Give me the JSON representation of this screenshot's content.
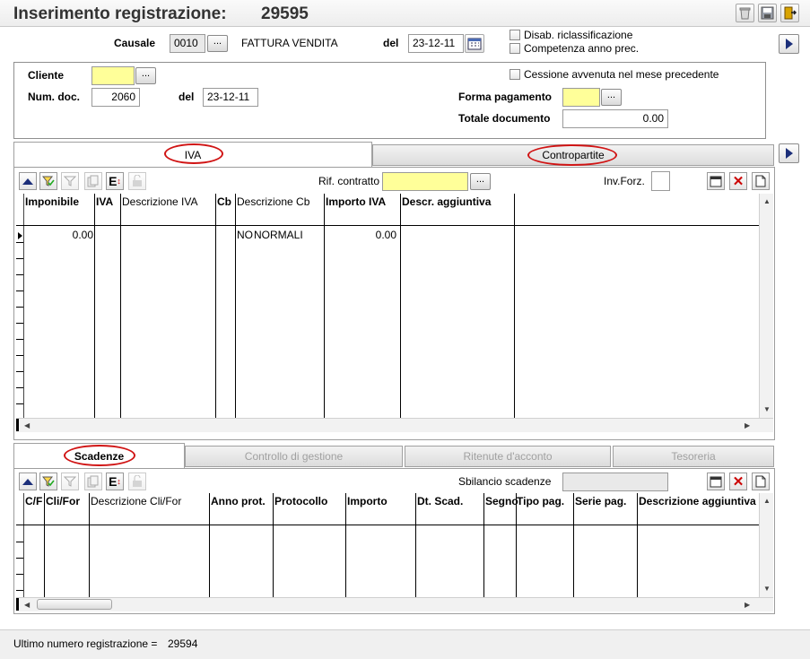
{
  "header": {
    "title": "Inserimento registrazione:",
    "number": "29595"
  },
  "causale": {
    "label": "Causale",
    "code": "0010",
    "btn": "...",
    "description": "FATTURA VENDITA",
    "del_label": "del",
    "date": "23-12-11"
  },
  "options": {
    "disab": "Disab. riclassificazione",
    "competenza": "Competenza anno prec.",
    "cessione": "Cessione avvenuta nel mese precedente"
  },
  "cliente": {
    "label": "Cliente",
    "value": "",
    "btn": "..."
  },
  "numdoc": {
    "label": "Num. doc.",
    "value": "2060",
    "del_label": "del",
    "date": "23-12-11"
  },
  "pagamento": {
    "label": "Forma pagamento",
    "btn": "..."
  },
  "totale": {
    "label": "Totale documento",
    "value": "0.00"
  },
  "tabs_top": {
    "iva": "IVA",
    "contropartite": "Contropartite"
  },
  "iva_toolbar": {
    "rif_label": "Rif. contratto",
    "rif_btn": "...",
    "inv_label": "Inv.Forz."
  },
  "iva_grid": {
    "columns": [
      "Imponibile",
      "IVA",
      "Descrizione IVA",
      "Cb",
      "Descrizione Cb",
      "Importo IVA",
      "Descr. aggiuntiva"
    ],
    "rows": [
      [
        "0.00",
        "",
        "",
        "NO",
        "NORMALI",
        "0.00",
        ""
      ]
    ]
  },
  "tabs_bottom": {
    "scadenze": "Scadenze",
    "controllo": "Controllo di gestione",
    "ritenute": "Ritenute d'acconto",
    "tesoreria": "Tesoreria"
  },
  "scad_toolbar": {
    "sbilancio_label": "Sbilancio scadenze"
  },
  "scad_grid": {
    "columns": [
      "C/F",
      "Cli/For",
      "Descrizione Cli/For",
      "Anno prot.",
      "Protocollo",
      "Importo",
      "Dt. Scad.",
      "Segno",
      "Tipo pag.",
      "Serie pag.",
      "Descrizione aggiuntiva"
    ]
  },
  "status": {
    "label": "Ultimo numero registrazione =",
    "value": "29594"
  },
  "colors": {
    "highlight": "#ffff99",
    "oval": "#d01414",
    "arrow": "#1c2f7a"
  }
}
